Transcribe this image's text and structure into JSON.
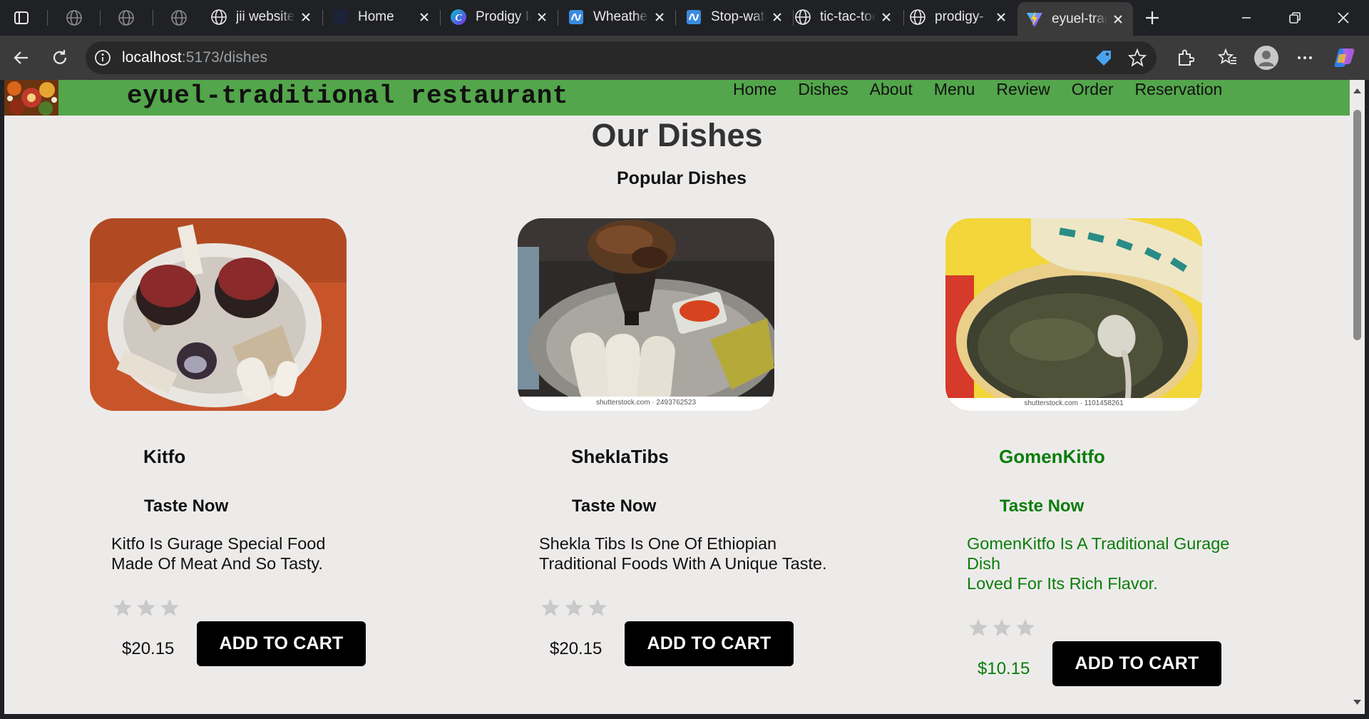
{
  "browser": {
    "tabs": [
      {
        "title": "jii website"
      },
      {
        "title": "Home"
      },
      {
        "title": "Prodigy Infotech"
      },
      {
        "title": "Wheather"
      },
      {
        "title": "Stop-watch"
      },
      {
        "title": "tic-tac-toe"
      },
      {
        "title": "prodigy-"
      },
      {
        "title": "eyuel-traditional"
      }
    ],
    "url_host": "localhost",
    "url_path": ":5173/dishes",
    "accent_color": "#53a64b"
  },
  "site": {
    "brand": "eyuel-traditional restaurant",
    "nav": [
      "Home",
      "Dishes",
      "About",
      "Menu",
      "Review",
      "Order",
      "Reservation"
    ]
  },
  "page": {
    "title": "Our Dishes",
    "subtitle": "Popular Dishes"
  },
  "dishes": [
    {
      "name": "Kitfo",
      "tagline": "Taste Now",
      "desc_line1": "Kitfo Is Gurage Special Food",
      "desc_line2": "Made Of Meat And So Tasty.",
      "price": "$20.15",
      "cart_label": "ADD TO CART",
      "rating": 0,
      "image_caption": ""
    },
    {
      "name": "ShekIaTibs",
      "tagline": "Taste Now",
      "desc_line1": "Shekla Tibs Is One Of Ethiopian",
      "desc_line2": "Traditional Foods With A Unique Taste.",
      "price": "$20.15",
      "cart_label": "ADD TO CART",
      "rating": 0,
      "image_caption": "shutterstock.com · 2493762523"
    },
    {
      "name": "GomenKitfo",
      "tagline": "Taste Now",
      "desc_line1": "GomenKitfo Is A Traditional Gurage",
      "desc_line2": "Dish",
      "desc_line3": "Loved For Its Rich Flavor.",
      "price": "$10.15",
      "cart_label": "ADD TO CART",
      "rating": 0,
      "image_caption": "shutterstock.com · 1101458261"
    }
  ]
}
